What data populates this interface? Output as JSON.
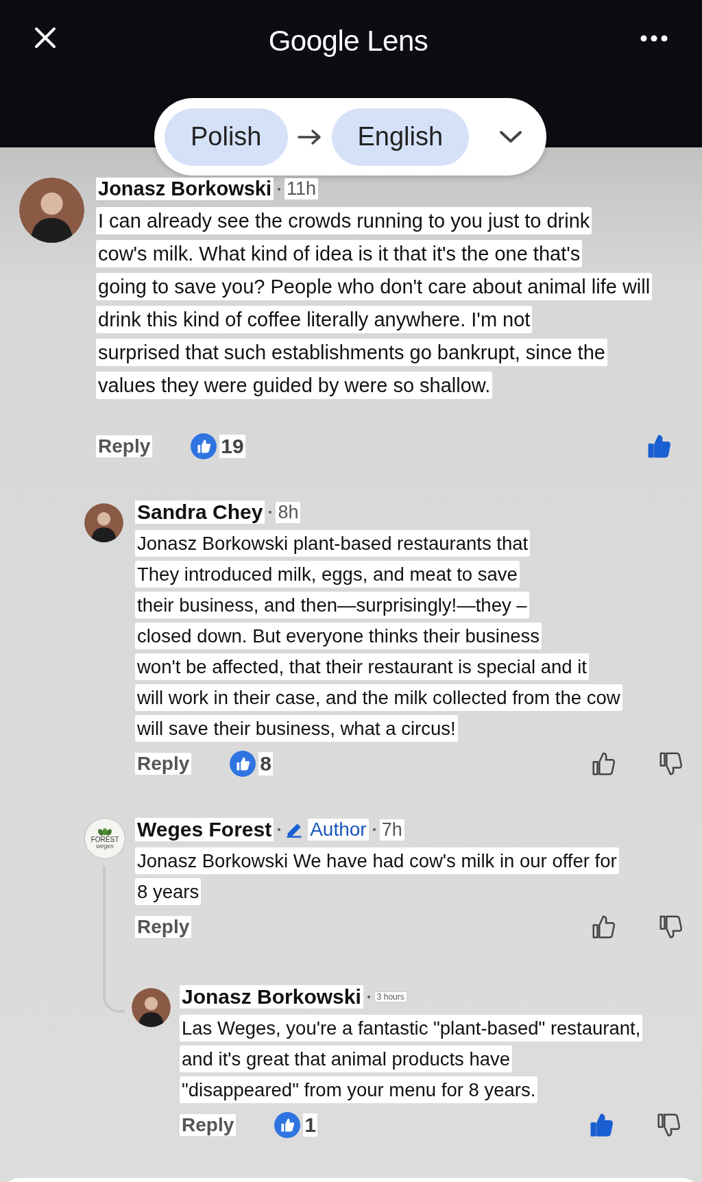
{
  "header": {
    "title": "Google Lens"
  },
  "translate": {
    "source": "Polish",
    "target": "English"
  },
  "comments": [
    {
      "author": "Jonasz Borkowski",
      "time": "11h",
      "lines": [
        "I can already see the crowds running to you just to drink",
        "cow's milk. What kind of idea is it that it's the one that's",
        "going to save you? People who don't care about animal life will",
        "drink this kind of coffee literally anywhere. I'm not",
        "surprised that such establishments go bankrupt, since the",
        "values they were guided by were so shallow."
      ],
      "reply": "Reply",
      "likes": "19",
      "liked": true,
      "dislike_button": false,
      "children": [
        {
          "author": "Sandra Chey",
          "time": "8h",
          "lines": [
            "Jonasz Borkowski plant-based restaurants that",
            "They introduced milk, eggs, and meat to save",
            "their business, and then—surprisingly!—they  –",
            "closed down. But everyone thinks their business",
            "won't be affected, that their restaurant is special and it",
            "will work in their case, and the milk collected from the cow",
            "will save their business, what a circus!"
          ],
          "reply": "Reply",
          "likes": "8",
          "liked": false,
          "dislike_button": true
        },
        {
          "author": "Weges Forest",
          "logo_text": "FOREST",
          "logo_subtext": "weges",
          "badge": "Author",
          "time": "7h",
          "lines": [
            "Jonasz Borkowski We have had cow's milk in our offer for",
            "8 years"
          ],
          "reply": "Reply",
          "liked": false,
          "dislike_button": true,
          "children": [
            {
              "author": "Jonasz Borkowski",
              "time": "3 hours",
              "lines": [
                "Las Weges, you're a fantastic \"plant-based\" restaurant,",
                "and it's great that animal products have",
                "\"disappeared\" from your menu for 8 years."
              ],
              "reply": "Reply",
              "likes": "1",
              "liked": true,
              "dislike_button": true
            }
          ]
        }
      ]
    }
  ]
}
